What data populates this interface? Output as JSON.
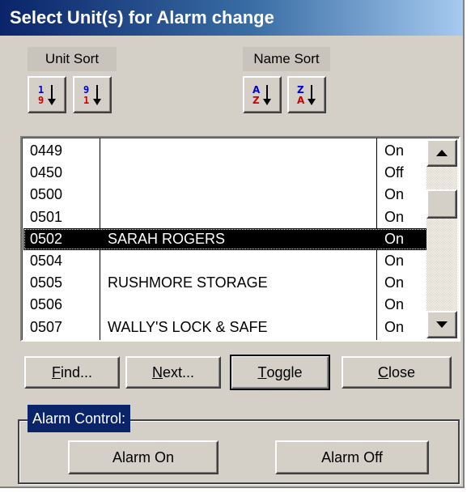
{
  "window": {
    "title": "Select Unit(s) for Alarm change"
  },
  "sort": {
    "unit_label": "Unit Sort",
    "name_label": "Name Sort",
    "buttons": [
      {
        "icon": "sort-numeric-ascending-icon",
        "top": "1",
        "bottom": "9"
      },
      {
        "icon": "sort-numeric-descending-icon",
        "top": "9",
        "bottom": "1"
      },
      {
        "icon": "sort-alpha-ascending-icon",
        "top": "A",
        "bottom": "Z"
      },
      {
        "icon": "sort-alpha-descending-icon",
        "top": "Z",
        "bottom": "A"
      }
    ]
  },
  "list": {
    "rows": [
      {
        "unit": "0449",
        "name": "",
        "status": "On"
      },
      {
        "unit": "0450",
        "name": "",
        "status": "Off"
      },
      {
        "unit": "0500",
        "name": "",
        "status": "On"
      },
      {
        "unit": "0501",
        "name": "",
        "status": "On"
      },
      {
        "unit": "0502",
        "name": "SARAH ROGERS",
        "status": "On",
        "selected": true
      },
      {
        "unit": "0504",
        "name": "",
        "status": "On"
      },
      {
        "unit": "0505",
        "name": "RUSHMORE STORAGE",
        "status": "On"
      },
      {
        "unit": "0506",
        "name": "",
        "status": "On"
      },
      {
        "unit": "0507",
        "name": "WALLY'S LOCK & SAFE",
        "status": "On"
      }
    ]
  },
  "actions": {
    "find": {
      "mnemonic": "F",
      "rest": "ind..."
    },
    "next": {
      "mnemonic": "N",
      "rest": "ext..."
    },
    "toggle": {
      "mnemonic": "T",
      "rest": "oggle"
    },
    "close": {
      "mnemonic": "C",
      "rest": "lose"
    }
  },
  "alarm_control": {
    "title": "Alarm Control:",
    "on_label": "Alarm On",
    "off_label": "Alarm Off"
  },
  "colors": {
    "face": "#d4d0c8",
    "title_start": "#0a246a",
    "title_end": "#a6caf0",
    "selection": "#000000",
    "sort_top_glyph": "#0000cc",
    "sort_bottom_glyph": "#cc0000"
  }
}
